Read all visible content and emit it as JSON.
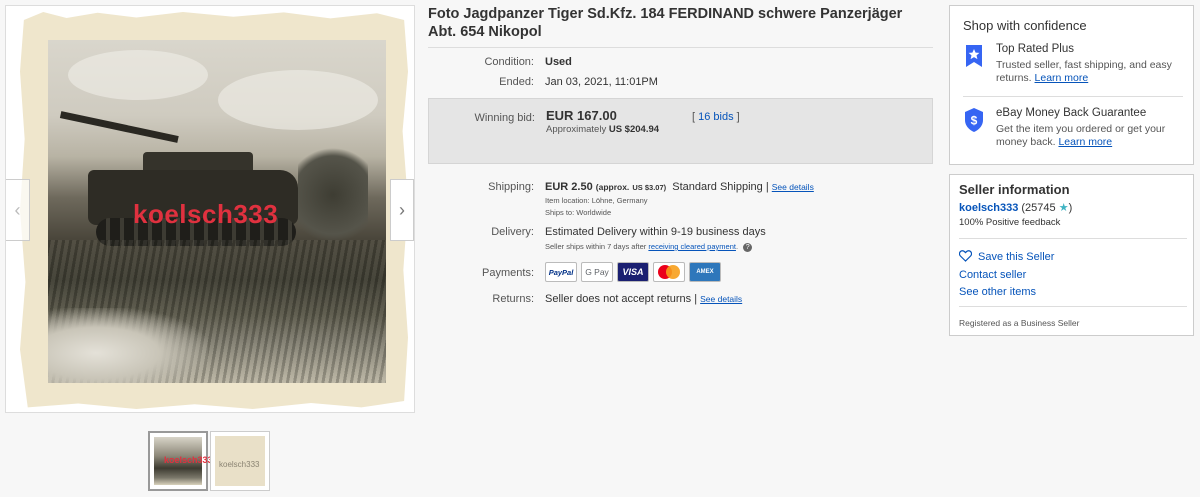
{
  "listing": {
    "title": "Foto Jagdpanzer Tiger Sd.Kfz. 184 FERDINAND schwere Panzerjäger Abt. 654 Nikopol",
    "watermark": "koelsch333",
    "thumbnail_watermark": "koelsch333"
  },
  "details": {
    "condition_label": "Condition:",
    "condition_value": "Used",
    "ended_label": "Ended:",
    "ended_value": "Jan 03, 2021, 11:01PM",
    "winning_bid_label": "Winning bid:",
    "winning_bid_amount": "EUR 167.00",
    "approx_prefix": "Approximately",
    "approx_value": "US $204.94",
    "bids_open": "[",
    "bids_link": "16 bids",
    "bids_close": "]",
    "shipping_label": "Shipping:",
    "shipping_value": "EUR 2.50",
    "shipping_approx": "(approx.",
    "shipping_approx_value": "US $3.07)",
    "shipping_service": "Standard Shipping |",
    "see_details": "See details",
    "item_location": "Item location:  Löhne, Germany",
    "ships_to": "Ships to:  Worldwide",
    "delivery_label": "Delivery:",
    "delivery_value": "Estimated Delivery within 9-19 business days",
    "delivery_note": "Seller ships within 7 days after",
    "delivery_note_link": "receiving cleared payment",
    "delivery_note_end": ".",
    "payments_label": "Payments:",
    "payment_methods": [
      "PayPal",
      "G Pay",
      "VISA",
      "",
      "AMEX"
    ],
    "returns_label": "Returns:",
    "returns_value": "Seller does not accept returns |",
    "returns_see_details": "See details"
  },
  "confidence": {
    "heading": "Shop with confidence",
    "top_rated_title": "Top Rated Plus",
    "top_rated_desc": "Trusted seller, fast shipping, and easy returns.",
    "learn_more": "Learn more",
    "guarantee_title": "eBay Money Back Guarantee",
    "guarantee_desc": "Get the item you ordered or get your money back.",
    "learn_more_2": "Learn more"
  },
  "seller": {
    "heading": "Seller information",
    "name": "koelsch333",
    "feedback_count": "(25745",
    "feedback_close": ")",
    "positive": "100% Positive feedback",
    "save": "Save this Seller",
    "contact": "Contact seller",
    "other_items": "See other items",
    "registered": "Registered as a Business Seller"
  },
  "colors": {
    "link": "#0654ba",
    "watermark": "#e0313f",
    "badge_blue": "#3665f3"
  }
}
